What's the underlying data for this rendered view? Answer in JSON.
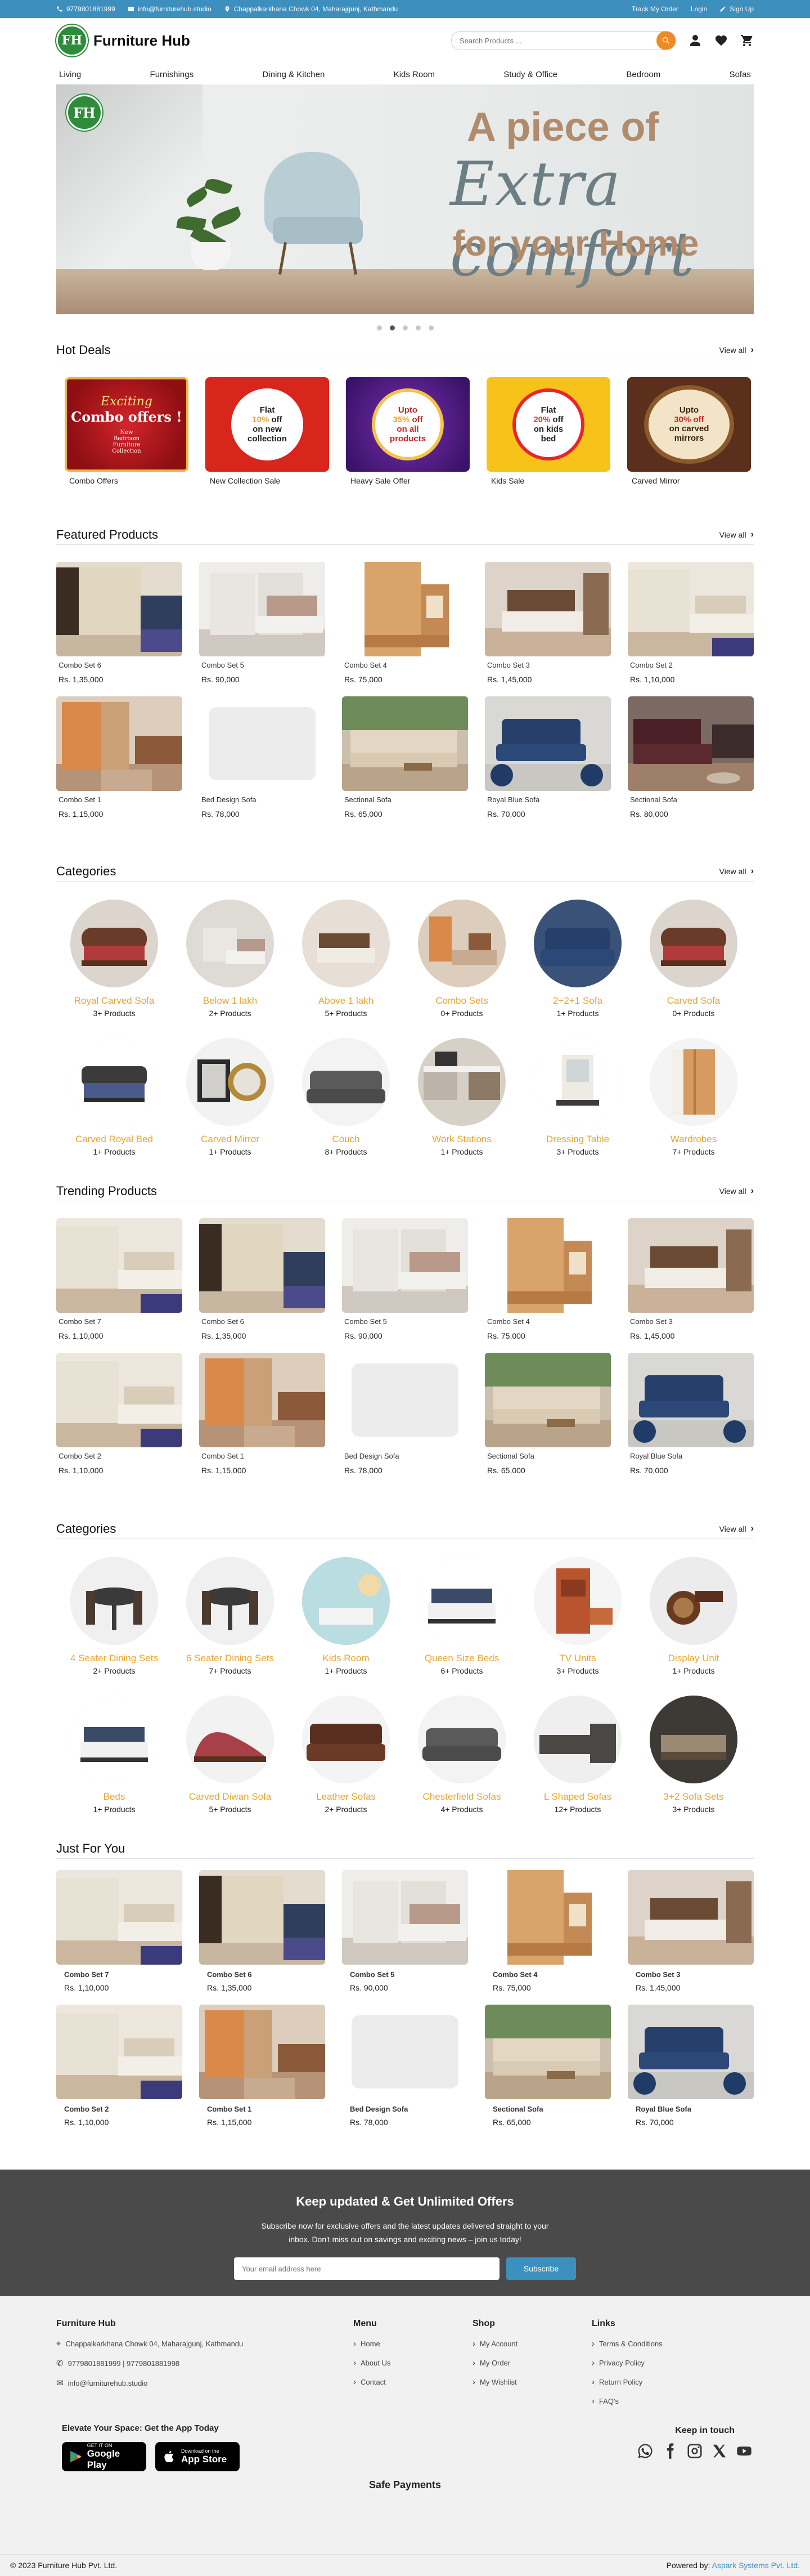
{
  "topbar": {
    "phone": "9779801881999",
    "email": "info@furniturehub.studio",
    "address": "Chappalkarkhana Chowk 04, Maharajgunj, Kathmandu",
    "track": "Track My Order",
    "login": "Login",
    "signup": "Sign Up"
  },
  "header": {
    "logo_mark": "FH",
    "brand": "Furniture Hub",
    "search_placeholder": "Search Products ..."
  },
  "nav": [
    "Living",
    "Furnishings",
    "Dining & Kitchen",
    "Kids Room",
    "Study & Office",
    "Bedroom",
    "Sofas"
  ],
  "hero": {
    "line1": "A piece of",
    "line2": "Extra comfort",
    "line3": "for your Home",
    "slides": 5,
    "active_slide": 2
  },
  "hot_deals": {
    "title": "Hot Deals",
    "view_all": "View all",
    "items": [
      {
        "caption": "Combo Offers",
        "art": [
          "Exciting",
          "Combo offers !",
          "New",
          "Bedroom",
          "Furniture",
          "Collection"
        ],
        "bg": "#b8141a"
      },
      {
        "caption": "New Collection Sale",
        "art": [
          "Flat",
          "10%",
          "off",
          "on new",
          "collection"
        ],
        "bg": "#d8261c"
      },
      {
        "caption": "Heavy Sale Offer",
        "art": [
          "Upto",
          "35%",
          "off",
          "on all",
          "products"
        ],
        "bg": "#4a1b7a"
      },
      {
        "caption": "Kids Sale",
        "art": [
          "Flat",
          "20%",
          "off",
          "on kids",
          "bed"
        ],
        "bg": "#f7c21a"
      },
      {
        "caption": "Carved Mirror",
        "art": [
          "Upto",
          "30%",
          "off",
          "on carved",
          "mirrors"
        ],
        "bg": "#5a2f1c"
      }
    ]
  },
  "featured": {
    "title": "Featured Products",
    "view_all": "View all",
    "items": [
      {
        "name": "Combo Set 6",
        "price": "Rs. 1,35,000",
        "img": "wardrobe-room"
      },
      {
        "name": "Combo Set 5",
        "price": "Rs. 90,000",
        "img": "bed-white"
      },
      {
        "name": "Combo Set 4",
        "price": "Rs. 75,000",
        "img": "tv-unit"
      },
      {
        "name": "Combo Set 3",
        "price": "Rs. 1,45,000",
        "img": "bed-brown"
      },
      {
        "name": "Combo Set 2",
        "price": "Rs. 1,10,000",
        "img": "bed-cream"
      },
      {
        "name": "Combo Set 1",
        "price": "Rs. 1,15,000",
        "img": "wardrobe-orange"
      },
      {
        "name": "Bed Design Sofa",
        "price": "Rs. 78,000",
        "img": "placeholder"
      },
      {
        "name": "Sectional Sofa",
        "price": "Rs. 65,000",
        "img": "sofa-beige"
      },
      {
        "name": "Royal Blue Sofa",
        "price": "Rs. 70,000",
        "img": "sofa-blue"
      },
      {
        "name": "Sectional Sofa",
        "price": "Rs. 80,000",
        "img": "sofa-maroon"
      }
    ]
  },
  "categories1": {
    "title": "Categories",
    "view_all": "View all",
    "items": [
      {
        "name": "Royal Carved Sofa",
        "count": "3+ Products",
        "img": "carved-sofa"
      },
      {
        "name": "Below 1 lakh",
        "count": "2+ Products",
        "img": "bed-white"
      },
      {
        "name": "Above 1 lakh",
        "count": "5+ Products",
        "img": "bed-brown"
      },
      {
        "name": "Combo Sets",
        "count": "0+ Products",
        "img": "wardrobe-orange"
      },
      {
        "name": "2+2+1 Sofa",
        "count": "1+ Products",
        "img": "sofa-blue"
      },
      {
        "name": "Carved Sofa",
        "count": "0+ Products",
        "img": "carved-sofa"
      },
      {
        "name": "Carved Royal Bed",
        "count": "1+ Products",
        "img": "royal-bed"
      },
      {
        "name": "Carved Mirror",
        "count": "1+ Products",
        "img": "mirror"
      },
      {
        "name": "Couch",
        "count": "8+ Products",
        "img": "couch"
      },
      {
        "name": "Work Stations",
        "count": "1+ Products",
        "img": "workstation"
      },
      {
        "name": "Dressing Table",
        "count": "3+ Products",
        "img": "dressing"
      },
      {
        "name": "Wardrobes",
        "count": "7+ Products",
        "img": "wardrobe"
      }
    ]
  },
  "trending": {
    "title": "Trending Products",
    "view_all": "View all",
    "items": [
      {
        "name": "Combo Set 7",
        "price": "Rs. 1,10,000",
        "img": "bed-cream"
      },
      {
        "name": "Combo Set 6",
        "price": "Rs. 1,35,000",
        "img": "wardrobe-room"
      },
      {
        "name": "Combo Set 5",
        "price": "Rs. 90,000",
        "img": "bed-white"
      },
      {
        "name": "Combo Set 4",
        "price": "Rs. 75,000",
        "img": "tv-unit"
      },
      {
        "name": "Combo Set 3",
        "price": "Rs. 1,45,000",
        "img": "bed-brown"
      },
      {
        "name": "Combo Set 2",
        "price": "Rs. 1,10,000",
        "img": "bed-cream"
      },
      {
        "name": "Combo Set 1",
        "price": "Rs. 1,15,000",
        "img": "wardrobe-orange"
      },
      {
        "name": "Bed Design Sofa",
        "price": "Rs. 78,000",
        "img": "placeholder"
      },
      {
        "name": "Sectional Sofa",
        "price": "Rs. 65,000",
        "img": "sofa-beige"
      },
      {
        "name": "Royal Blue Sofa",
        "price": "Rs. 70,000",
        "img": "sofa-blue"
      }
    ]
  },
  "categories2": {
    "title": "Categories",
    "view_all": "View all",
    "items": [
      {
        "name": "4 Seater Dining Sets",
        "count": "2+ Products",
        "img": "dining"
      },
      {
        "name": "6 Seater Dining Sets",
        "count": "7+ Products",
        "img": "dining"
      },
      {
        "name": "Kids Room",
        "count": "1+ Products",
        "img": "kids"
      },
      {
        "name": "Queen Size Beds",
        "count": "6+ Products",
        "img": "queen-bed"
      },
      {
        "name": "TV Units",
        "count": "3+ Products",
        "img": "tv-unit"
      },
      {
        "name": "Display Unit",
        "count": "1+ Products",
        "img": "display"
      },
      {
        "name": "Beds",
        "count": "1+ Products",
        "img": "queen-bed"
      },
      {
        "name": "Carved Diwan Sofa",
        "count": "5+ Products",
        "img": "diwan"
      },
      {
        "name": "Leather Sofas",
        "count": "2+ Products",
        "img": "leather"
      },
      {
        "name": "Chesterfield Sofas",
        "count": "4+ Products",
        "img": "couch"
      },
      {
        "name": "L Shaped Sofas",
        "count": "12+ Products",
        "img": "lshape"
      },
      {
        "name": "3+2 Sofa Sets",
        "count": "3+ Products",
        "img": "sofaset"
      }
    ]
  },
  "just_for_you": {
    "title": "Just For You",
    "items": [
      {
        "name": "Combo Set 7",
        "price": "Rs. 1,10,000",
        "img": "bed-cream"
      },
      {
        "name": "Combo Set 6",
        "price": "Rs. 1,35,000",
        "img": "wardrobe-room"
      },
      {
        "name": "Combo Set 5",
        "price": "Rs. 90,000",
        "img": "bed-white"
      },
      {
        "name": "Combo Set 4",
        "price": "Rs. 75,000",
        "img": "tv-unit"
      },
      {
        "name": "Combo Set 3",
        "price": "Rs. 1,45,000",
        "img": "bed-brown"
      },
      {
        "name": "Combo Set 2",
        "price": "Rs. 1,10,000",
        "img": "bed-cream"
      },
      {
        "name": "Combo Set 1",
        "price": "Rs. 1,15,000",
        "img": "wardrobe-orange"
      },
      {
        "name": "Bed Design Sofa",
        "price": "Rs. 78,000",
        "img": "placeholder"
      },
      {
        "name": "Sectional Sofa",
        "price": "Rs. 65,000",
        "img": "sofa-beige"
      },
      {
        "name": "Royal Blue Sofa",
        "price": "Rs. 70,000",
        "img": "sofa-blue"
      }
    ]
  },
  "newsletter": {
    "title": "Keep updated & Get Unlimited Offers",
    "text1": "Subscribe now for exclusive offers and the latest updates delivered straight to your",
    "text2": "inbox. Don't miss out on savings and exciting news – join us today!",
    "placeholder": "Your email address here",
    "button": "Subscribe"
  },
  "footer": {
    "brand": "Furniture Hub",
    "address": "Chappalkarkhana Chowk 04, Maharajgunj, Kathmandu",
    "phones": "9779801881999 | 9779801881998",
    "email": "info@furniturehub.studio",
    "menu_title": "Menu",
    "menu": [
      "Home",
      "About Us",
      "Contact"
    ],
    "shop_title": "Shop",
    "shop": [
      "My Account",
      "My Order",
      "My Wishlist"
    ],
    "links_title": "Links",
    "links": [
      "Terms & Conditions",
      "Privacy Policy",
      "Return Policy",
      "FAQ's"
    ],
    "app_title": "Elevate Your Space: Get the App Today",
    "google_small": "GET IT ON",
    "google_big": "Google Play",
    "apple_small": "Download on the",
    "apple_big": "App Store",
    "touch_title": "Keep in touch",
    "social": [
      "whatsapp-icon",
      "facebook-icon",
      "instagram-icon",
      "x-icon",
      "youtube-icon"
    ],
    "payments_title": "Safe Payments",
    "copyright": "© 2023 Furniture Hub Pvt. Ltd.",
    "powered_prefix": "Powered by:",
    "powered_name": "Aspark Systems Pvt. Ltd."
  },
  "colors": {
    "topbar": "#3d8fbd",
    "accent": "#f08a24",
    "category_name": "#e8a530",
    "newsletter_bg": "#4a4a4a",
    "footer_bg": "#f1f1f1"
  }
}
